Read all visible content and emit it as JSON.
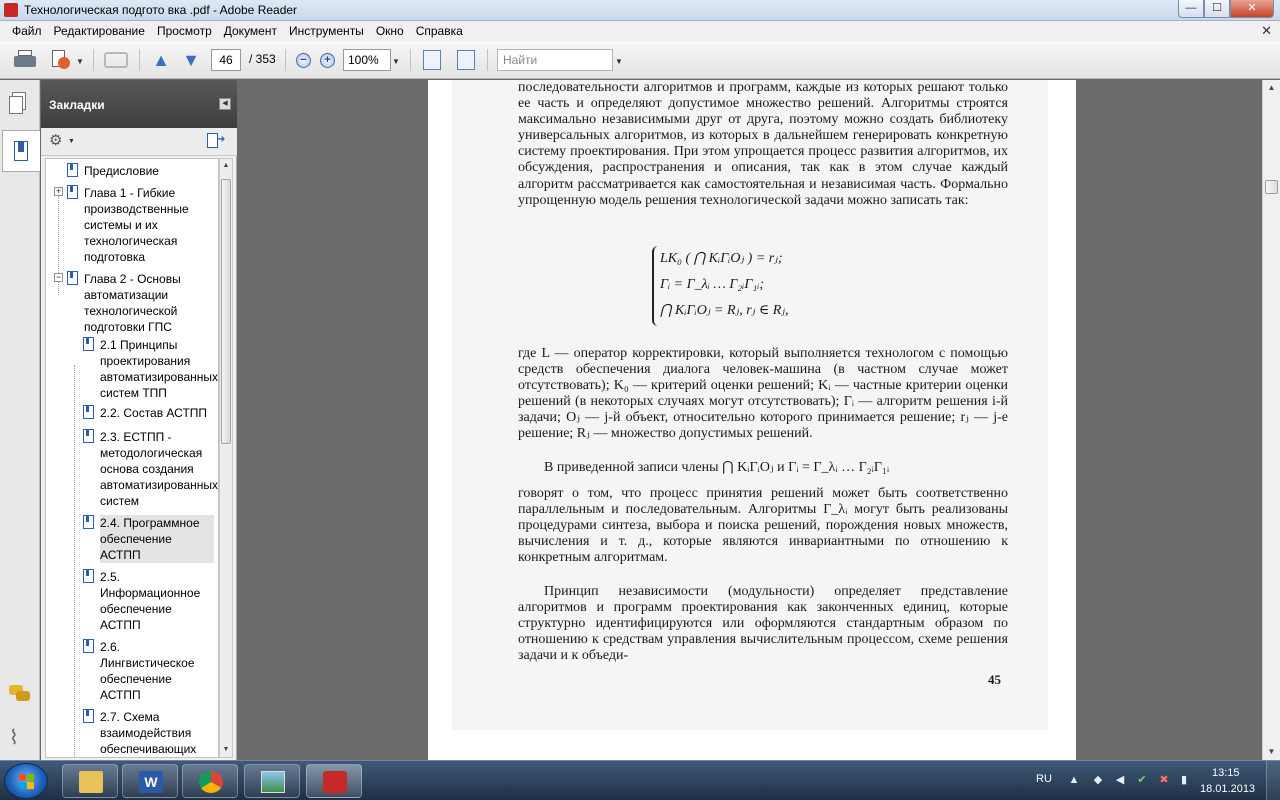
{
  "window": {
    "title": "Технологическая подгото вка .pdf - Adobe Reader",
    "controls": {
      "minimize": "—",
      "maximize": "☐",
      "close": "✕"
    }
  },
  "menu": {
    "items": [
      "Файл",
      "Редактирование",
      "Просмотр",
      "Документ",
      "Инструменты",
      "Окно",
      "Справка"
    ],
    "close_doc": "✕"
  },
  "toolbar": {
    "page_current": "46",
    "page_total": "/ 353",
    "zoom": "100%",
    "search_placeholder": "Найти",
    "icons": [
      "printer-icon",
      "share-icon",
      "collaborate-icon",
      "previous-page-icon",
      "next-page-icon",
      "zoom-out-icon",
      "zoom-in-icon",
      "fit-width-icon",
      "fit-page-icon"
    ]
  },
  "sidebar": {
    "icons": [
      "pages-icon",
      "bookmarks-icon",
      "comments-icon",
      "attachments-icon"
    ]
  },
  "bookmarks": {
    "title": "Закладки",
    "items": [
      {
        "label": "Предисловие"
      },
      {
        "label": "Глава 1 - Гибкие производственные системы и их технологическая подготовка"
      },
      {
        "label": "Глава 2 - Основы автоматизации технологической подготовки ГПС"
      },
      {
        "label": "2.1  Принципы проектирования автоматизированных систем ТПП"
      },
      {
        "label": "2.2. Состав АСТПП"
      },
      {
        "label": "2.3. ЕСТПП - методологическая основа создания автоматизированных систем"
      },
      {
        "label": "2.4. Программное обеспечение АСТПП",
        "selected": true
      },
      {
        "label": "2.5. Информационное обеспечение АСТПП"
      },
      {
        "label": "2.6. Лингвистическое обеспечение АСТПП"
      },
      {
        "label": "2.7. Схема взаимодействия обеспечивающих"
      }
    ]
  },
  "document": {
    "para1": "последовательности алгоритмов и программ, каждые из которых решают только ее часть и определяют допустимое множество решений. Алгоритмы строятся максимально независимыми друг от друга, поэтому можно создать библиотеку универсальных алгоритмов, из которых в дальнейшем генерировать конкретную систему проектирования. При этом упрощается процесс развития алгоритмов, их обсуждения, распространения и описания, так как в этом случае каждый алгоритм рассматривается как самостоятельная и независимая часть. Формально упрощенную модель решения технологической задачи можно записать так:",
    "formula": [
      "LK₀ ( ⋂ KᵢΓᵢOⱼ ) = rⱼ;",
      "Γᵢ = Γ_λᵢ … Γ₂ᵢΓ₁ᵢ;",
      "⋂ KᵢΓᵢOⱼ = Rⱼ, rⱼ ∈ Rⱼ,"
    ],
    "para2": "где L — оператор корректировки, который выполняется технологом с помощью средств обеспечения диалога человек-машина (в частном случае может отсутствовать); K₀ — критерий оценки решений; Kᵢ — частные критерии оценки решений (в некоторых случаях могут отсутствовать); Γᵢ — алгоритм решения i-й задачи; Oⱼ — j-й объект, относительно которого принимается решение; rⱼ — j-е решение; Rⱼ — множество допустимых решений.",
    "para3": "В приведенной записи члены ⋂ KᵢΓᵢOⱼ и Γᵢ = Γ_λᵢ … Γ₂ᵢΓ₁ᵢ",
    "para4": "говорят о том, что процесс принятия решений может быть соответственно параллельным и последовательным. Алгоритмы Γ_λᵢ могут быть реализованы процедурами синтеза, выбора и поиска решений, порождения новых множеств, вычисления и т. д., которые являются инвариантными по отношению к конкретным алгоритмам.",
    "para5": "Принцип независимости (модульности) определяет представление алгоритмов и программ проектирования как законченных единиц, которые структурно идентифицируются или оформляются стандартным образом по отношению к средствам управления вычислительным процессом, схеме решения задачи и к объеди-",
    "page_number": "45"
  },
  "taskbar": {
    "apps": [
      "windows-explorer",
      "microsoft-word",
      "google-chrome",
      "picture-viewer",
      "adobe-reader"
    ],
    "language": "RU",
    "time": "13:15",
    "date": "18.01.2013"
  },
  "colors": {
    "panel_header": "#4a4a4a",
    "link_blue": "#2f5ea8",
    "doc_background": "#6b6b6b",
    "taskbar": "#2a3f5a"
  }
}
